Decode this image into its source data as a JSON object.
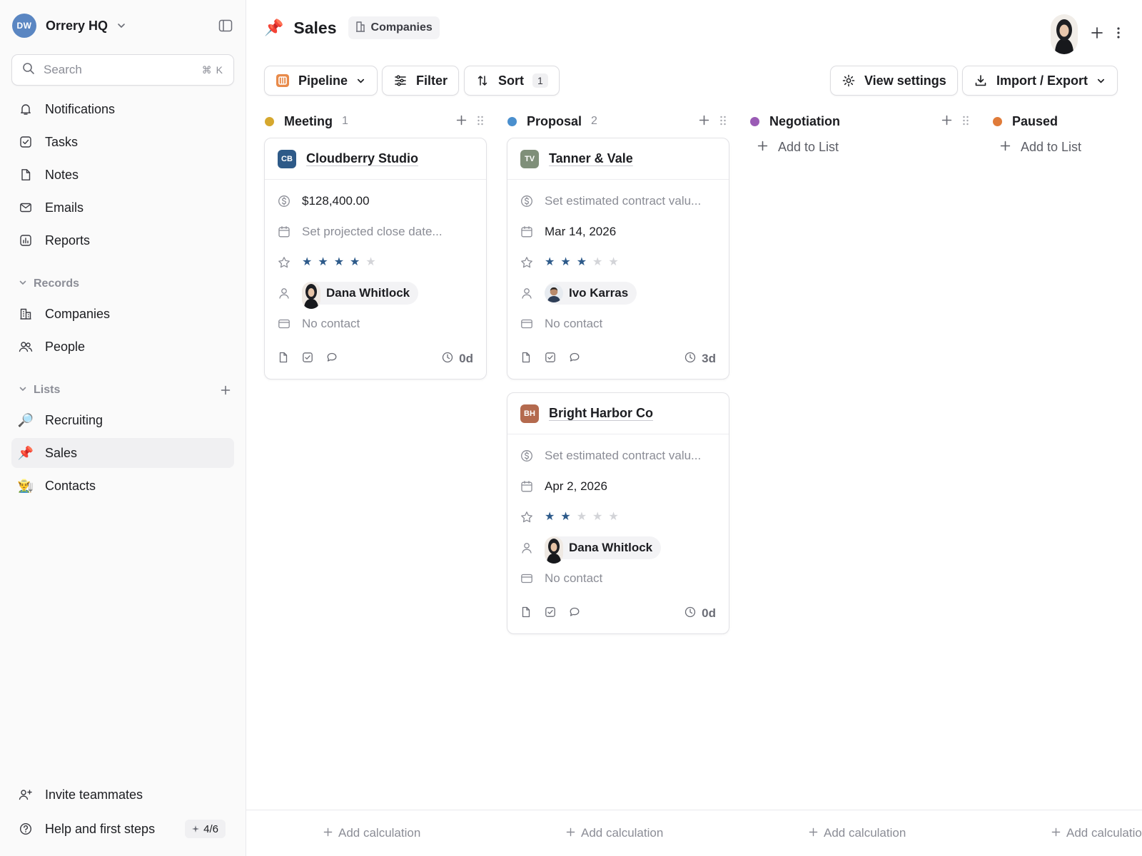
{
  "workspace": {
    "initials": "DW",
    "name": "Orrery HQ"
  },
  "search": {
    "placeholder": "Search",
    "shortcut": "⌘ K"
  },
  "nav": [
    {
      "label": "Notifications",
      "icon": "bell-icon"
    },
    {
      "label": "Tasks",
      "icon": "checkbox-icon"
    },
    {
      "label": "Notes",
      "icon": "document-icon"
    },
    {
      "label": "Emails",
      "icon": "mail-icon"
    },
    {
      "label": "Reports",
      "icon": "chart-icon"
    }
  ],
  "records": {
    "title": "Records",
    "items": [
      {
        "label": "Companies",
        "icon": "building-icon"
      },
      {
        "label": "People",
        "icon": "people-icon"
      }
    ]
  },
  "lists": {
    "title": "Lists",
    "items": [
      {
        "label": "Recruiting",
        "emoji": "🔎"
      },
      {
        "label": "Sales",
        "emoji": "📌"
      },
      {
        "label": "Contacts",
        "emoji": "👨‍🌾"
      }
    ]
  },
  "sidebar_footer": {
    "invite": "Invite teammates",
    "help": "Help and first steps",
    "progress": "4/6"
  },
  "page": {
    "emoji": "📌",
    "title": "Sales",
    "object_chip": "Companies"
  },
  "toolbar": {
    "view": "Pipeline",
    "filter": "Filter",
    "sort": "Sort",
    "sort_count": "1",
    "view_settings": "View settings",
    "import_export": "Import / Export"
  },
  "columns": [
    {
      "title": "Meeting",
      "count": "1",
      "color": "#d6a82e"
    },
    {
      "title": "Proposal",
      "count": "2",
      "color": "#4a8fce"
    },
    {
      "title": "Negotiation",
      "count": "",
      "color": "#9a5bb5"
    },
    {
      "title": "Paused",
      "count": "",
      "color": "#e07b39"
    }
  ],
  "add_to_list": "Add to List",
  "add_calculation": "Add calculation",
  "cards": [
    {
      "logo": "CB",
      "logo_color": "#2e5a88",
      "name": "Cloudberry Studio",
      "value": "$128,400.00",
      "close_date": "Set projected close date...",
      "rating": 4,
      "owner": "Dana Whitlock",
      "contact": "No contact",
      "age": "0d"
    },
    {
      "logo": "TV",
      "logo_color": "#7f8f79",
      "name": "Tanner & Vale",
      "value": "Set estimated contract valu...",
      "close_date": "Mar 14, 2026",
      "rating": 3,
      "owner": "Ivo Karras",
      "contact": "No contact",
      "age": "3d"
    },
    {
      "logo": "BH",
      "logo_color": "#b46a4e",
      "name": "Bright Harbor Co",
      "value": "Set estimated contract valu...",
      "close_date": "Apr 2, 2026",
      "rating": 2,
      "owner": "Dana Whitlock",
      "contact": "No contact",
      "age": "0d"
    }
  ],
  "colors": {
    "star_on": "#2d5a8a",
    "star_off": "#d3d4d8",
    "accent": "#1c1d21",
    "muted": "#8b8d96"
  }
}
